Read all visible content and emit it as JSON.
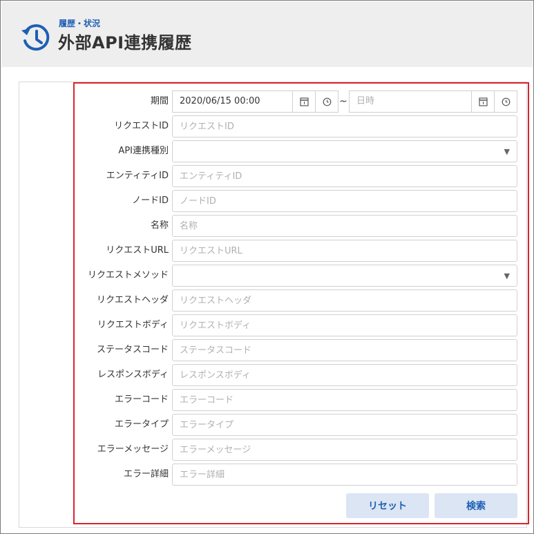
{
  "header": {
    "subtitle": "履歴・状況",
    "title": "外部API連携履歴"
  },
  "form": {
    "period": {
      "label": "期間",
      "from_value": "2020/06/15 00:00",
      "separator": "~",
      "to_placeholder": "日時"
    },
    "request_id": {
      "label": "リクエストID",
      "placeholder": "リクエストID"
    },
    "api_type": {
      "label": "API連携種別",
      "value": ""
    },
    "entity_id": {
      "label": "エンティティID",
      "placeholder": "エンティティID"
    },
    "node_id": {
      "label": "ノードID",
      "placeholder": "ノードID"
    },
    "name": {
      "label": "名称",
      "placeholder": "名称"
    },
    "request_url": {
      "label": "リクエストURL",
      "placeholder": "リクエストURL"
    },
    "request_method": {
      "label": "リクエストメソッド",
      "value": ""
    },
    "request_header": {
      "label": "リクエストヘッダ",
      "placeholder": "リクエストヘッダ"
    },
    "request_body": {
      "label": "リクエストボディ",
      "placeholder": "リクエストボディ"
    },
    "status_code": {
      "label": "ステータスコード",
      "placeholder": "ステータスコード"
    },
    "response_body": {
      "label": "レスポンスボディ",
      "placeholder": "レスポンスボディ"
    },
    "error_code": {
      "label": "エラーコード",
      "placeholder": "エラーコード"
    },
    "error_type": {
      "label": "エラータイプ",
      "placeholder": "エラータイプ"
    },
    "error_message": {
      "label": "エラーメッセージ",
      "placeholder": "エラーメッセージ"
    },
    "error_detail": {
      "label": "エラー詳細",
      "placeholder": "エラー詳細"
    }
  },
  "buttons": {
    "reset": "リセット",
    "search": "検索"
  },
  "icons": {
    "header": "history-icon",
    "calendar": "calendar-icon",
    "clock": "clock-icon",
    "dropdown": "chevron-down-icon"
  },
  "colors": {
    "accent": "#1e5fb4",
    "highlight_border": "#d9232c",
    "header_bg": "#eeeeee",
    "button_bg": "#dbe5f3"
  }
}
